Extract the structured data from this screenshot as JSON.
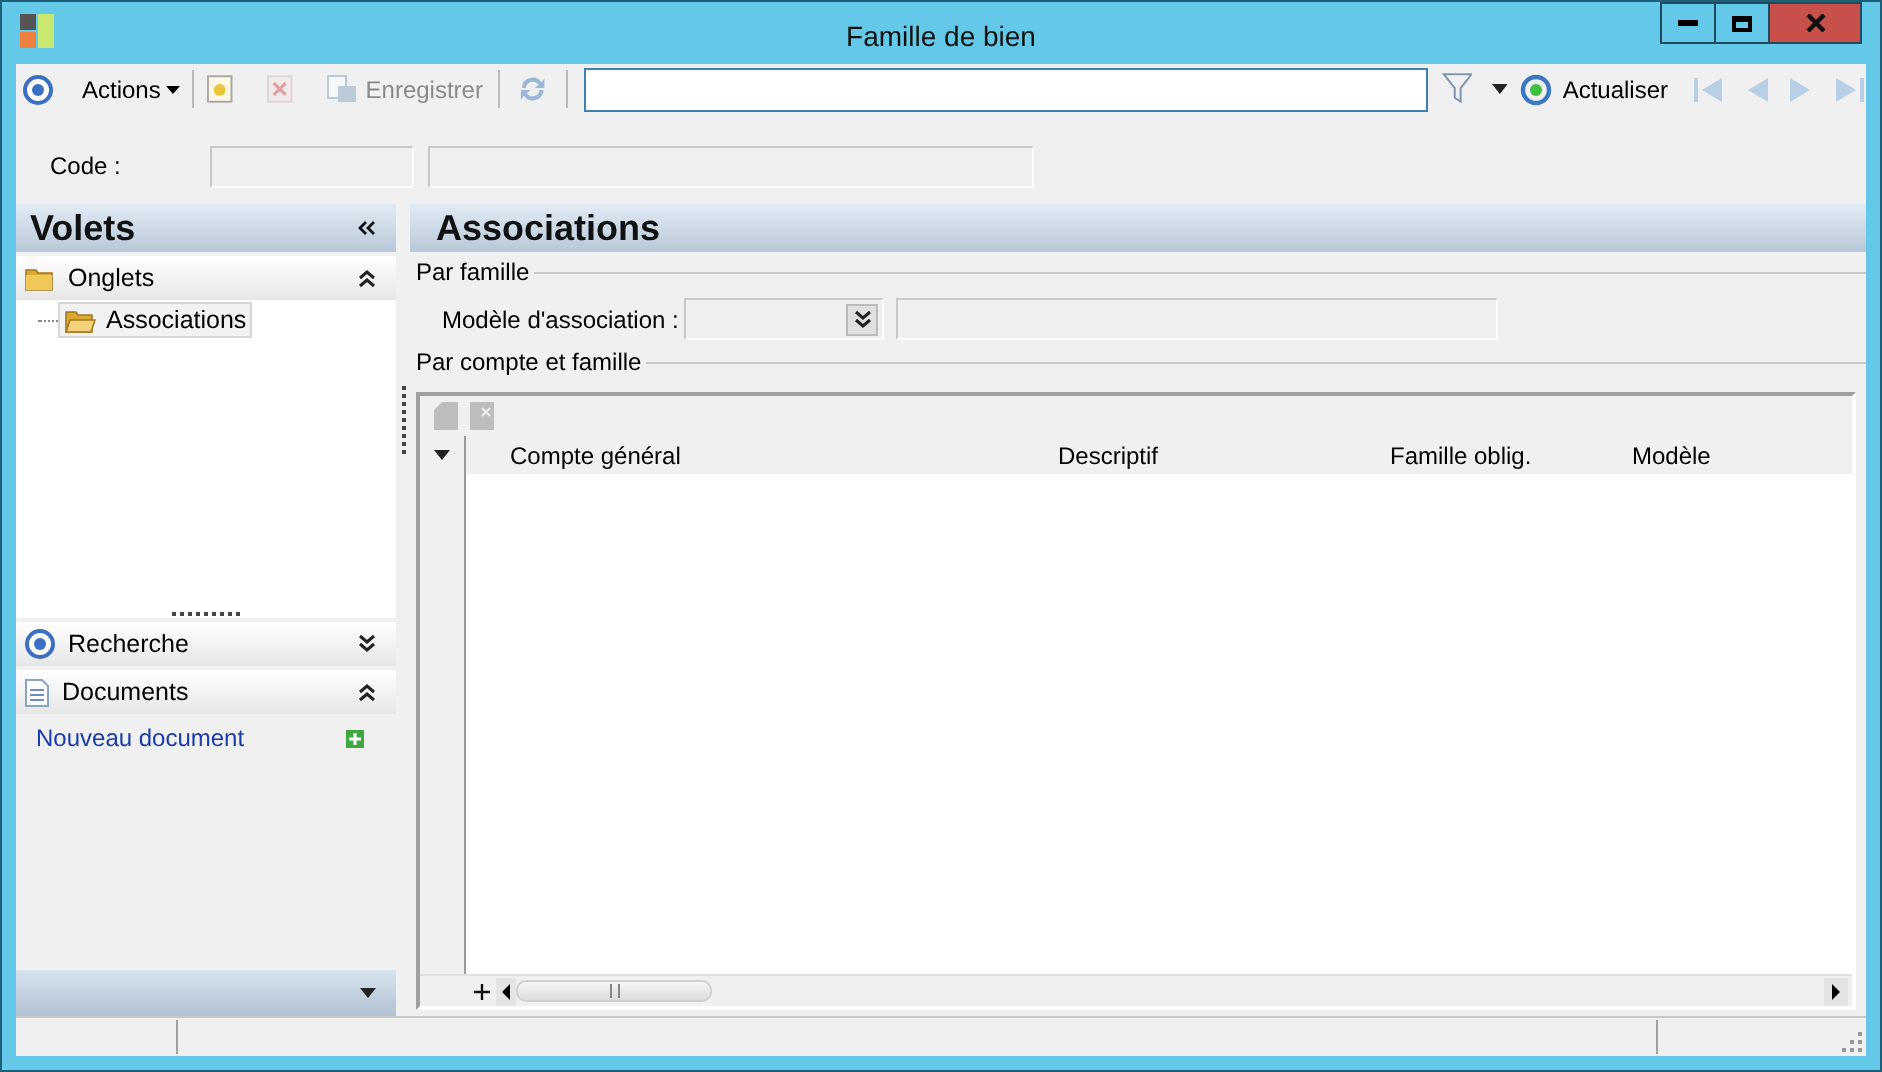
{
  "window": {
    "title": "Famille de bien"
  },
  "toolbar": {
    "actions": "Actions",
    "delete_disabled": true,
    "save": {
      "label": "Enregistrer",
      "disabled": true
    },
    "refresh": "Actualiser",
    "nav_disabled": true
  },
  "code": {
    "label": "Code :"
  },
  "sidebar": {
    "title": "Volets",
    "sections": [
      {
        "title": "Onglets",
        "kind": "tree",
        "expanded": true,
        "items": [
          {
            "label": "Associations",
            "selected": true
          }
        ]
      },
      {
        "title": "Recherche",
        "kind": "search",
        "expanded": false
      },
      {
        "title": "Documents",
        "kind": "links",
        "expanded": true,
        "links": [
          "Nouveau document"
        ]
      }
    ]
  },
  "content": {
    "title": "Associations",
    "par_famille": {
      "title": "Par famille",
      "label": "Modèle d'association :"
    },
    "par_compte": {
      "title": "Par compte et famille",
      "columns": [
        "Compte général",
        "Descriptif",
        "Famille oblig.",
        "Modèle"
      ]
    }
  }
}
